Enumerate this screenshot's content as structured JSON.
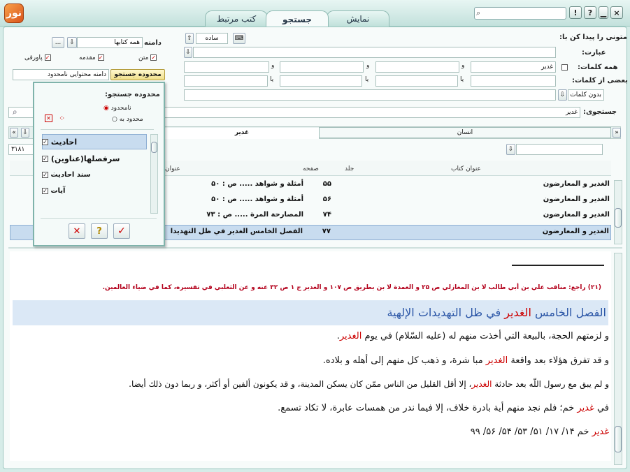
{
  "window": {
    "tabs": [
      "نمایش",
      "جستجو",
      "کتب مرتبط"
    ],
    "active_tab": "جستجو",
    "controls": [
      "?",
      "!",
      "×"
    ]
  },
  "search_form": {
    "scope_label": "دامنه",
    "scope_value": "همه کتابها",
    "scope_more": "...",
    "options": {
      "matn": "متن",
      "moqadame": "مقدمه",
      "pavaraqi": "پاورقی"
    },
    "search_range_button": "محدوده جستجو",
    "search_range_value": "دامنه محتوایی نامحدود",
    "find_text_label": "متونی را پیدا کن با:",
    "mode_value": "ساده",
    "phrase_label": "عبارت:",
    "all_words_label": "همه کلمات:",
    "all_words_value": "غدیر",
    "and_label": "و",
    "some_words_label": "بعضی از کلمات:",
    "or_label": "یا",
    "without_value": "بدون کلمات",
    "search_label": "جستجوی:",
    "search_value": "غدیر"
  },
  "popup": {
    "title": "محدوده جستجو:",
    "radio_unlimited": "نامحدود",
    "radio_limited": "محدود به",
    "items": [
      "احادیث",
      "سرفصلها(عناوین)",
      "سند احادیث",
      "آیات"
    ]
  },
  "results": {
    "tab_right": "انسان",
    "tab_left": "غدیر",
    "count": "۳۱۸۱",
    "col_book": "عنوان کتاب",
    "col_vol": "جلد",
    "col_page": "صفحه",
    "col_text": "عنوان",
    "rows": [
      {
        "book": "الغدير و المعارضون",
        "page": "۵۵",
        "text": "أمثلة و شواهد ..... ص : ۵۰"
      },
      {
        "book": "الغدير و المعارضون",
        "page": "۵۶",
        "text": "أمثلة و شواهد ..... ص : ۵۰"
      },
      {
        "book": "الغدير و المعارضون",
        "page": "۷۴",
        "text": "المصارحة المرة ..... ص : ۷۳"
      },
      {
        "book": "الغدير و المعارضون",
        "page": "۷۷",
        "text": "الفصل الخامس الغدير في ظل التهديدا"
      }
    ]
  },
  "document": {
    "footnote": "(۲۱) راجع: مناقب علي بن أبي طالب لا بن المغازلي ص ۲۵ و العمدة لا بن بطريق ص ۱۰۷ و الغدير ج ۱ ص ۳۲ عنه و عن الثعلبي في تفسيره، كما في ضياء العالمين.",
    "heading_pre": "الفصل الخامس ",
    "heading_hl": "الغدير",
    "heading_post": " في ظل التهديدات الإلهية",
    "p1_pre": "و لزمتهم الحجة، بالبيعة التي أخذت منهم له (عليه السّلام) في يوم ",
    "p1_hl": "الغدير",
    "p1_post": ".",
    "p2_pre": "و قد تفرق هؤلاء بعد واقعة ",
    "p2_hl": "الغدير",
    "p2_post": " مبا شرة، و ذهب كل منهم إلى أهله و بلاده.",
    "p3_pre": "و لم يبق مع رسول اللّه بعد حادثة ",
    "p3_hl": "الغدير",
    "p3_post": "، إلا أقل القليل من الناس ممّن كان يسكن المدينة، و قد يكونون ألفين أو أكثر، و ربما دون ذلك أيضا.",
    "p4_pre": "في ",
    "p4_hl": "غدير",
    "p4_post": " خم؛ فلم نجد منهم أية بادرة خلاف، إلا فيما ندر من همسات عابرة، لا تكاد تسمع.",
    "p5_hl": "غدير",
    "p5_post": " خم ۱۴/ ۱۷/ ۵۱/ ۵۳/ ۵۴/ ۵۶/ ۹۹"
  },
  "colors": {
    "highlight": "#cc0000",
    "heading": "#2a55a6",
    "selected_row": "#c8dcef"
  }
}
